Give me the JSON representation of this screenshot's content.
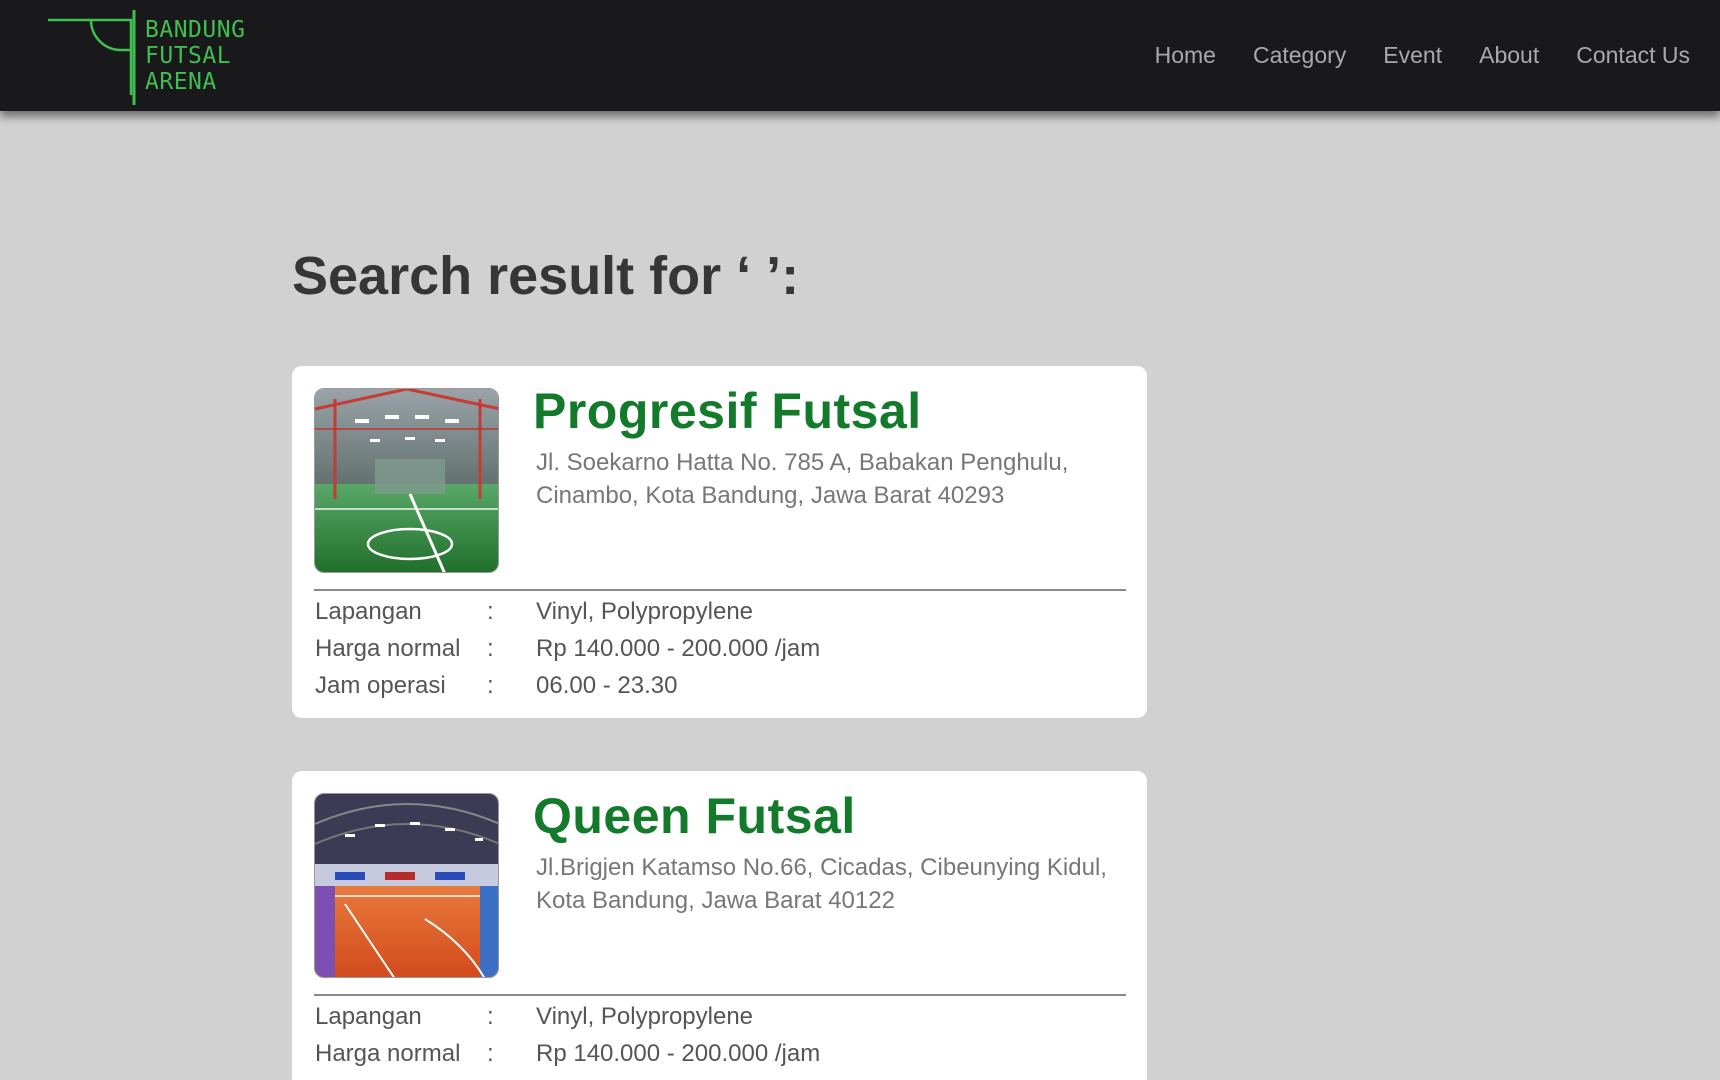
{
  "brand": {
    "lines": [
      "BANDUNG",
      "FUTSAL",
      "ARENA"
    ],
    "accent_color": "#3fbf4f"
  },
  "nav": {
    "items": [
      "Home",
      "Category",
      "Event",
      "About",
      "Contact Us"
    ]
  },
  "search": {
    "title": "Search result for ‘ ’:"
  },
  "results": [
    {
      "name": "Progresif Futsal",
      "address_line1": "Jl. Soekarno Hatta No. 785 A, Babakan Penghulu,",
      "address_line2": "Cinambo, Kota Bandung, Jawa Barat 40293",
      "image": "green-indoor-futsal-field-photo",
      "details": [
        {
          "label": "Lapangan",
          "sep": ":",
          "value": "Vinyl, Polypropylene"
        },
        {
          "label": "Harga normal",
          "sep": ":",
          "value": "Rp 140.000 - 200.000 /jam"
        },
        {
          "label": "Jam operasi",
          "sep": ":",
          "value": "06.00 - 23.30"
        }
      ]
    },
    {
      "name": "Queen Futsal",
      "address_line1": "Jl.Brigjen Katamso No.66, Cicadas, Cibeunying Kidul,",
      "address_line2": "Kota Bandung, Jawa Barat 40122",
      "image": "orange-indoor-futsal-court-photo",
      "details": [
        {
          "label": "Lapangan",
          "sep": ":",
          "value": "Vinyl, Polypropylene"
        },
        {
          "label": "Harga normal",
          "sep": ":",
          "value": "Rp 140.000 - 200.000 /jam"
        }
      ]
    }
  ],
  "colors": {
    "header_bg": "#19191b",
    "page_bg": "#d1d1d1",
    "venue_name": "#137a2b"
  }
}
